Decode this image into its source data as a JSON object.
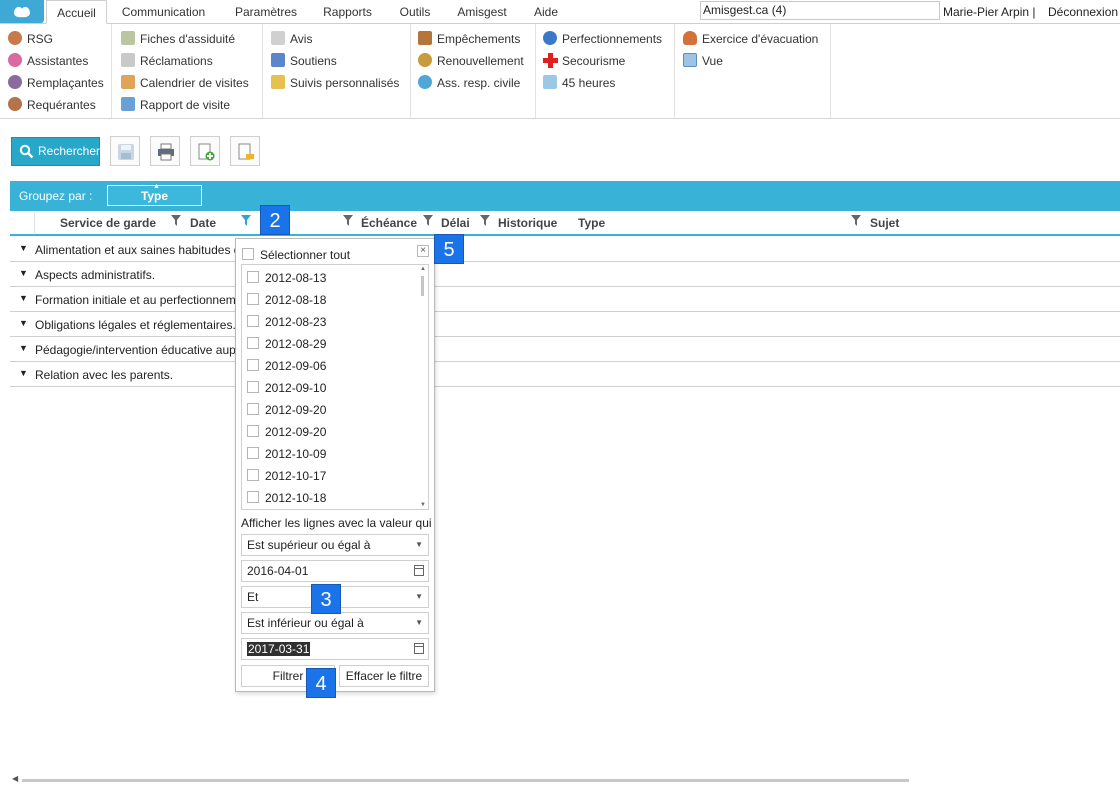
{
  "tabs": [
    "Accueil",
    "Communication",
    "Paramètres",
    "Rapports",
    "Outils",
    "Amisgest",
    "Aide"
  ],
  "site": "Amisgest.ca (4)",
  "user": "Marie-Pier Arpin |",
  "logout": "Déconnexion",
  "ribbon": {
    "g1": [
      "RSG",
      "Assistantes",
      "Remplaçantes",
      "Requérantes"
    ],
    "g2": [
      "Fiches d'assiduité",
      "Réclamations",
      "Calendrier de visites",
      "Rapport de visite"
    ],
    "g3": [
      "Avis",
      "Soutiens",
      "Suivis personnalisés"
    ],
    "g4": [
      "Empêchements",
      "Renouvellement",
      "Ass. resp. civile"
    ],
    "g5": [
      "Perfectionnements",
      "Secourisme",
      "45 heures"
    ],
    "g6": [
      "Exercice d'évacuation",
      "Vue"
    ]
  },
  "toolbar": {
    "search_label": "Rechercher"
  },
  "group_by": {
    "label": "Groupez par :",
    "chip": "Type"
  },
  "columns": [
    "Service de garde",
    "Date",
    "Échéance",
    "Délai",
    "Historique",
    "Type",
    "Sujet"
  ],
  "groups": [
    "Alimentation et aux saines habitudes d",
    "Aspects administratifs.",
    "Formation initiale et au perfectionnem",
    "Obligations légales et réglementaires.",
    "Pédagogie/intervention éducative aup",
    "Relation avec les parents."
  ],
  "filter": {
    "select_all": "Sélectionner tout",
    "dates": [
      "2012-08-13",
      "2012-08-18",
      "2012-08-23",
      "2012-08-29",
      "2012-09-06",
      "2012-09-10",
      "2012-09-20",
      "2012-09-20",
      "2012-10-09",
      "2012-10-17",
      "2012-10-18"
    ],
    "show_rows_label": "Afficher les lignes avec la valeur qui",
    "op1": "Est supérieur ou égal à",
    "date_from": "2016-04-01",
    "logic": "Et",
    "op2": "Est inférieur ou égal à",
    "date_to": "2017-03-31",
    "filter_button": "Filtrer",
    "clear_button": "Effacer le filtre",
    "close_glyph": "×"
  },
  "callouts": [
    "2",
    "3",
    "4",
    "5"
  ],
  "colors": {
    "accent": "#38b3d7",
    "callout": "#1a73e8"
  }
}
